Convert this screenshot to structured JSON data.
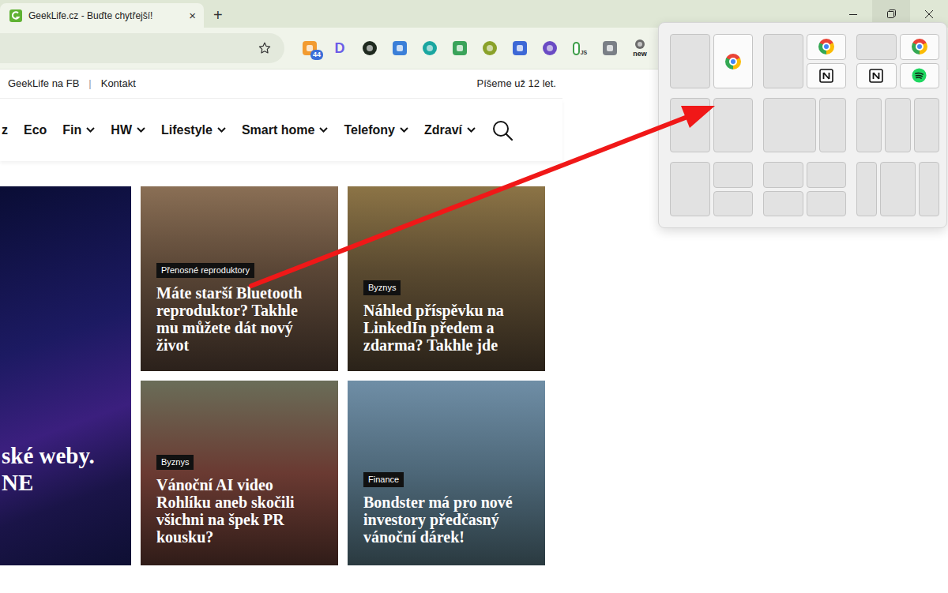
{
  "window": {
    "controls": [
      {
        "kind": "minimize",
        "hovered": false
      },
      {
        "kind": "restore",
        "hovered": true
      },
      {
        "kind": "close",
        "hovered": false
      }
    ]
  },
  "tabs": [
    {
      "label": "GeekLife.cz - Buďte chytřejší!",
      "selected": true,
      "close": "×"
    }
  ],
  "new_tab": "+",
  "toolbar": {
    "extensions": [
      {
        "kind": "square",
        "color": "#f29b30",
        "badge": "44"
      },
      {
        "kind": "letter",
        "color": "#6b5ce7",
        "glyph": "D"
      },
      {
        "kind": "circle",
        "color": "#1f2a1f"
      },
      {
        "kind": "square",
        "color": "#3b7fd8"
      },
      {
        "kind": "circle",
        "color": "#1aa6a0"
      },
      {
        "kind": "square",
        "color": "#3aa35a"
      },
      {
        "kind": "circle",
        "color": "#8aa12a"
      },
      {
        "kind": "square",
        "color": "#3d68d6"
      },
      {
        "kind": "circle",
        "color": "#6a4bc4"
      },
      {
        "kind": "pill",
        "color": "#3f9f4a",
        "glyph": "JS"
      },
      {
        "kind": "square",
        "color": "#7a7f86"
      },
      {
        "kind": "circle",
        "color": "#6b6b6b",
        "label": "new"
      }
    ]
  },
  "site": {
    "top_links": [
      {
        "label": "GeekLife na FB"
      },
      {
        "label": "Kontakt"
      }
    ],
    "separator": "|",
    "tagline": "Píšeme už 12 let.",
    "nav": [
      {
        "label": "z",
        "dropdown": false
      },
      {
        "label": "Eco",
        "dropdown": false
      },
      {
        "label": "Fin",
        "dropdown": true
      },
      {
        "label": "HW",
        "dropdown": true
      },
      {
        "label": "Lifestyle",
        "dropdown": true
      },
      {
        "label": "Smart home",
        "dropdown": true
      },
      {
        "label": "Telefony",
        "dropdown": true
      },
      {
        "label": "Zdraví",
        "dropdown": true
      }
    ],
    "hero": {
      "lines": [
        "ské weby.",
        "NE"
      ]
    },
    "articles": [
      {
        "tag": "Přenosné reproduktory",
        "title": "Máte starší Bluetooth reproduktor? Takhle mu můžete dát nový život"
      },
      {
        "tag": "Byznys",
        "title": "Náhled příspěvku na LinkedIn předem a zdarma? Takhle jde"
      },
      {
        "tag": "Byznys",
        "title": "Vánoční AI video Rohlíku aneb skočili všichni na špek PR kousku?"
      },
      {
        "tag": "Finance",
        "title": "Bondster má pro nové investory předčasný vánoční dárek!"
      }
    ]
  },
  "snap_layouts": [
    {
      "kind": "halves",
      "zones": [
        {
          "kind": "empty"
        },
        {
          "kind": "chrome"
        }
      ]
    },
    {
      "kind": "main-stack",
      "zones": [
        {
          "kind": "empty"
        },
        {
          "kind": "chrome"
        },
        {
          "kind": "notion"
        }
      ]
    },
    {
      "kind": "quad",
      "zones": [
        {
          "kind": "empty"
        },
        {
          "kind": "chrome"
        },
        {
          "kind": "notion"
        },
        {
          "kind": "spotify"
        }
      ]
    },
    {
      "kind": "halves",
      "zones": [
        {
          "kind": "empty"
        },
        {
          "kind": "empty"
        }
      ]
    },
    {
      "kind": "wide-narrow",
      "zones": [
        {
          "kind": "empty"
        },
        {
          "kind": "empty"
        }
      ]
    },
    {
      "kind": "thirds",
      "zones": [
        {
          "kind": "empty"
        },
        {
          "kind": "empty"
        },
        {
          "kind": "empty"
        }
      ]
    },
    {
      "kind": "half-stack",
      "zones": [
        {
          "kind": "empty"
        },
        {
          "kind": "empty"
        },
        {
          "kind": "empty"
        }
      ]
    },
    {
      "kind": "quad",
      "zones": [
        {
          "kind": "empty"
        },
        {
          "kind": "empty"
        },
        {
          "kind": "empty"
        },
        {
          "kind": "empty"
        }
      ]
    },
    {
      "kind": "narrow-wide-narrow",
      "zones": [
        {
          "kind": "empty"
        },
        {
          "kind": "empty"
        },
        {
          "kind": "empty"
        }
      ]
    }
  ]
}
